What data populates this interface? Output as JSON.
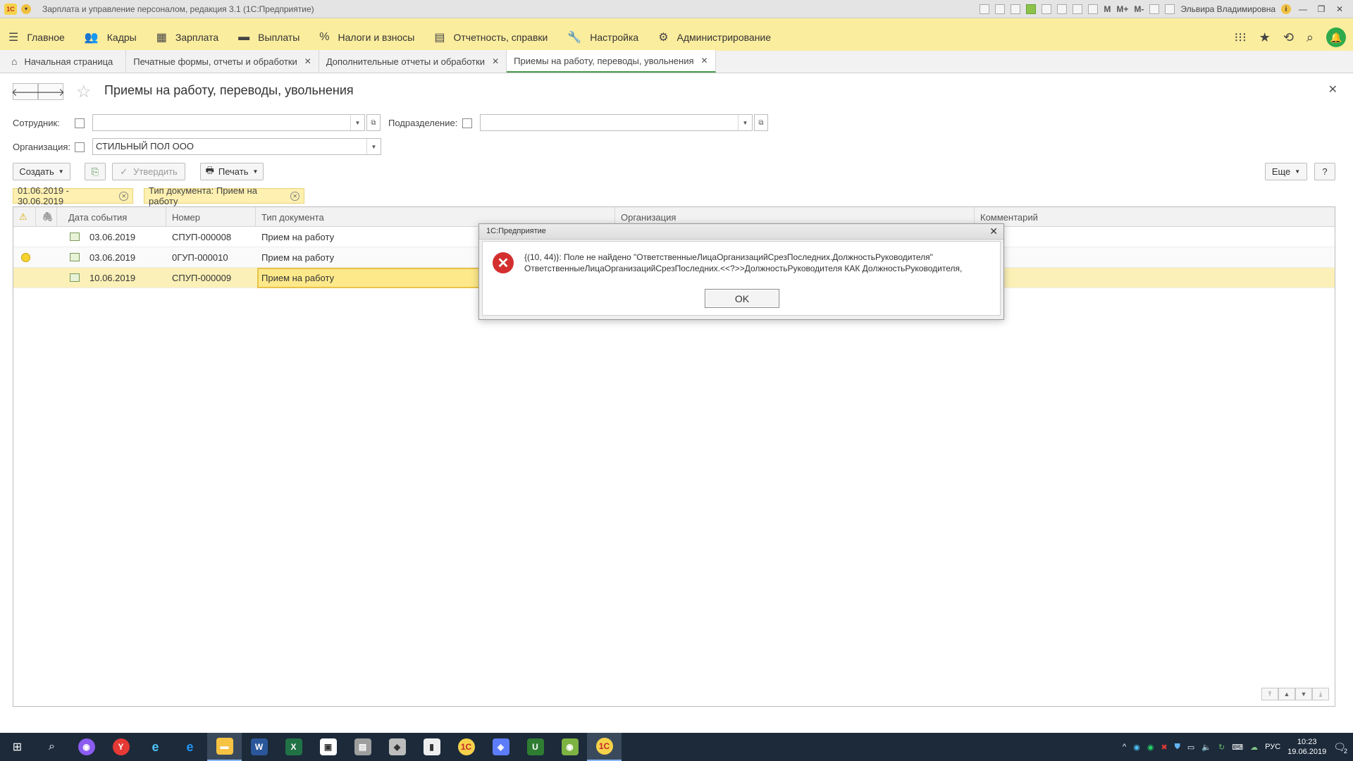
{
  "window": {
    "title": "Зарплата и управление персоналом, редакция 3.1  (1С:Предприятие)",
    "user": "Эльвира Владимировна",
    "m_buttons": [
      "M",
      "M+",
      "M-"
    ]
  },
  "menu": {
    "items": [
      {
        "label": "Главное",
        "icon": "hamburger-icon"
      },
      {
        "label": "Кадры",
        "icon": "people-icon"
      },
      {
        "label": "Зарплата",
        "icon": "calculator-icon"
      },
      {
        "label": "Выплаты",
        "icon": "wallet-icon"
      },
      {
        "label": "Налоги и взносы",
        "icon": "percent-icon"
      },
      {
        "label": "Отчетность, справки",
        "icon": "report-icon"
      },
      {
        "label": "Настройка",
        "icon": "wrench-icon"
      },
      {
        "label": "Администрирование",
        "icon": "gear-icon"
      }
    ]
  },
  "tabs": [
    {
      "label": "Начальная страница"
    },
    {
      "label": "Печатные формы, отчеты и обработки"
    },
    {
      "label": "Дополнительные отчеты и обработки"
    },
    {
      "label": "Приемы на работу, переводы, увольнения"
    }
  ],
  "page": {
    "title": "Приемы на работу, переводы, увольнения"
  },
  "filters": {
    "employee_label": "Сотрудник:",
    "employee_value": "",
    "department_label": "Подразделение:",
    "department_value": "",
    "organization_label": "Организация:",
    "organization_value": "СТИЛЬНЫЙ ПОЛ ООО"
  },
  "toolbar": {
    "create": "Создать",
    "approve": "Утвердить",
    "print": "Печать",
    "more": "Еще",
    "help": "?"
  },
  "chips": {
    "period": "01.06.2019 - 30.06.2019",
    "doc_type": "Тип документа: Прием на работу"
  },
  "table": {
    "headers": {
      "date": "Дата события",
      "number": "Номер",
      "doc_type": "Тип документа",
      "organization": "Организация",
      "comment": "Комментарий"
    },
    "rows": [
      {
        "date": "03.06.2019",
        "number": "СПУП-000008",
        "doc_type": "Прием на работу",
        "warning": false
      },
      {
        "date": "03.06.2019",
        "number": "0ГУП-000010",
        "doc_type": "Прием на работу",
        "warning": true
      },
      {
        "date": "10.06.2019",
        "number": "СПУП-000009",
        "doc_type": "Прием на работу",
        "warning": false
      }
    ]
  },
  "dialog": {
    "title": "1С:Предприятие",
    "line1": "{(10, 44)}: Поле не найдено \"ОтветственныеЛицаОрганизацийСрезПоследних.ДолжностьРуководителя\"",
    "line2": "ОтветственныеЛицаОрганизацийСрезПоследних.<<?>>ДолжностьРуководителя КАК ДолжностьРуководителя,",
    "ok": "OK"
  },
  "taskbar": {
    "lang": "РУС",
    "time": "10:23",
    "date": "19.06.2019",
    "notifications": "2"
  },
  "colors": {
    "menubar": "#fbed9e",
    "selected_row": "#fbf0b7",
    "error": "#d32f2f",
    "accent_green": "#2eaa4c"
  }
}
